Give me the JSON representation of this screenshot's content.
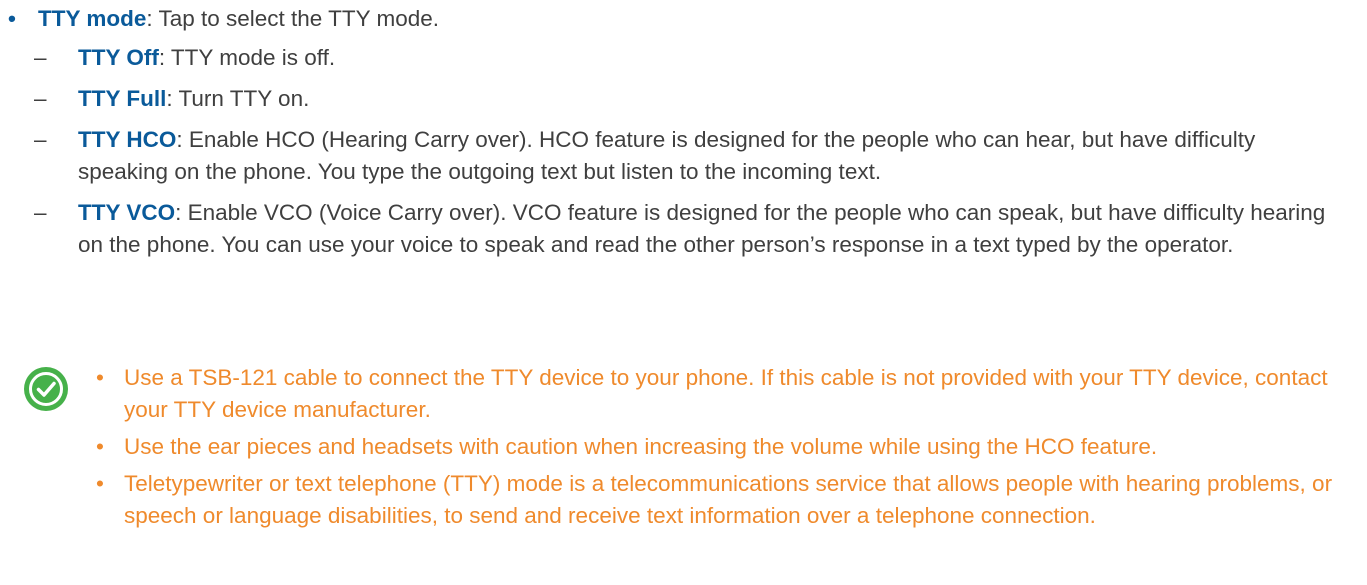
{
  "main": {
    "bullet": "•",
    "term": "TTY mode",
    "description": ": Tap to select the TTY mode."
  },
  "sub_items": [
    {
      "term": "TTY Off",
      "description": ": TTY mode is off."
    },
    {
      "term": "TTY Full",
      "description": ": Turn TTY on."
    },
    {
      "term": "TTY HCO",
      "description": ": Enable HCO (Hearing Carry over). HCO feature is designed for the people who can hear, but have difficulty speaking on the phone. You type the outgoing text but listen to the incoming text."
    },
    {
      "term": "TTY VCO",
      "description": ": Enable VCO (Voice Carry over). VCO feature is designed for the people who can speak, but have difficulty hearing on the phone. You can use your voice to speak and read the other person’s response in a text typed by the operator."
    }
  ],
  "sub_dash": "–",
  "note": {
    "icon": "checkmark-circle-icon",
    "icon_color": "#46b14a",
    "text_color": "#ef8a2c",
    "bullet": "•",
    "items": [
      "Use a TSB-121 cable to connect the TTY device to your phone. If this cable is not provided with your TTY device, contact your TTY device manufacturer.",
      "Use the ear pieces and headsets with caution when increasing the volume while using the HCO feature.",
      "Teletypewriter or text telephone (TTY) mode is a telecommunications service that allows people with hearing problems, or speech or language disabilities, to send and receive text information over a telephone connection."
    ]
  },
  "colors": {
    "term": "#0a5a9a",
    "body_text": "#3f3f3f",
    "note_text": "#ef8a2c",
    "note_icon": "#46b14a"
  }
}
